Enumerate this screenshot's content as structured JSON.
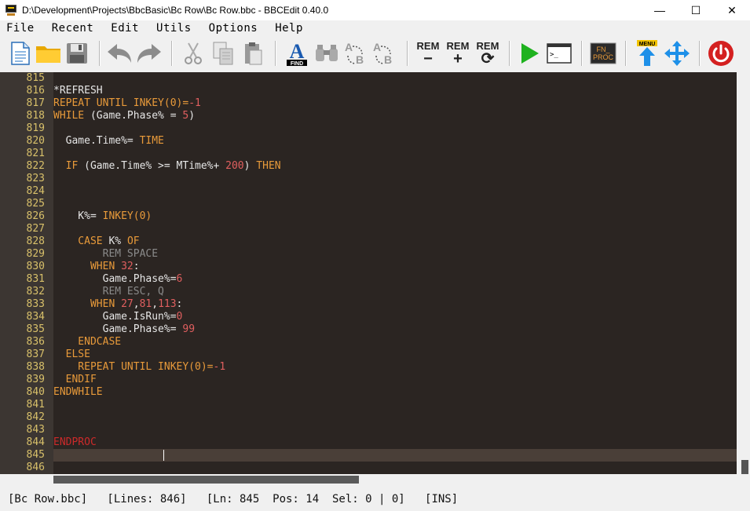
{
  "window": {
    "title": "D:\\Development\\Projects\\BbcBasic\\Bc Row\\Bc Row.bbc - BBCEdit 0.40.0",
    "minimize": "—",
    "maximize": "☐",
    "close": "✕"
  },
  "menu": [
    "File",
    "Recent",
    "Edit",
    "Utils",
    "Options",
    "Help"
  ],
  "toolbar": {
    "find_label": "FIND",
    "rem_label": "REM",
    "menu_label": "MENU",
    "fnproc_line1": "FN_",
    "fnproc_line2": "PROC",
    "terminal_prompt": ">_"
  },
  "colors": {
    "background": "#2b2522",
    "gutter": "#3c3632",
    "keyword": "#e89a3a",
    "number": "#e05f5f",
    "comment": "#8a8a8a",
    "line_number": "#d8c06a"
  },
  "editor": {
    "lines": [
      {
        "n": "815",
        "tokens": []
      },
      {
        "n": "816",
        "tokens": [
          {
            "t": "*REFRESH",
            "c": "tx"
          }
        ]
      },
      {
        "n": "817",
        "tokens": [
          {
            "t": "REPEAT UNTIL INKEY(0)=",
            "c": "kw"
          },
          {
            "t": "-1",
            "c": "num"
          }
        ]
      },
      {
        "n": "818",
        "tokens": [
          {
            "t": "WHILE ",
            "c": "kw"
          },
          {
            "t": "(Game.Phase% = ",
            "c": "tx"
          },
          {
            "t": "5",
            "c": "num"
          },
          {
            "t": ")",
            "c": "tx"
          }
        ]
      },
      {
        "n": "819",
        "tokens": []
      },
      {
        "n": "820",
        "tokens": [
          {
            "t": "  Game.Time%= ",
            "c": "tx"
          },
          {
            "t": "TIME",
            "c": "kw"
          }
        ]
      },
      {
        "n": "821",
        "tokens": []
      },
      {
        "n": "822",
        "tokens": [
          {
            "t": "  IF ",
            "c": "kw"
          },
          {
            "t": "(Game.Time% >= MTime%+ ",
            "c": "tx"
          },
          {
            "t": "200",
            "c": "num"
          },
          {
            "t": ") ",
            "c": "tx"
          },
          {
            "t": "THEN",
            "c": "kw"
          }
        ]
      },
      {
        "n": "823",
        "tokens": []
      },
      {
        "n": "824",
        "tokens": []
      },
      {
        "n": "825",
        "tokens": []
      },
      {
        "n": "826",
        "tokens": [
          {
            "t": "    K%= ",
            "c": "tx"
          },
          {
            "t": "INKEY(0)",
            "c": "kw"
          }
        ]
      },
      {
        "n": "827",
        "tokens": []
      },
      {
        "n": "828",
        "tokens": [
          {
            "t": "    CASE ",
            "c": "kw"
          },
          {
            "t": "K% ",
            "c": "tx"
          },
          {
            "t": "OF",
            "c": "kw"
          }
        ]
      },
      {
        "n": "829",
        "tokens": [
          {
            "t": "        REM SPACE",
            "c": "cm"
          }
        ]
      },
      {
        "n": "830",
        "tokens": [
          {
            "t": "      WHEN ",
            "c": "kw"
          },
          {
            "t": "32",
            "c": "num"
          },
          {
            "t": ":",
            "c": "tx"
          }
        ]
      },
      {
        "n": "831",
        "tokens": [
          {
            "t": "        Game.Phase%=",
            "c": "tx"
          },
          {
            "t": "6",
            "c": "num"
          }
        ]
      },
      {
        "n": "832",
        "tokens": [
          {
            "t": "        REM ESC, Q",
            "c": "cm"
          }
        ]
      },
      {
        "n": "833",
        "tokens": [
          {
            "t": "      WHEN ",
            "c": "kw"
          },
          {
            "t": "27",
            "c": "num"
          },
          {
            "t": ",",
            "c": "tx"
          },
          {
            "t": "81",
            "c": "num"
          },
          {
            "t": ",",
            "c": "tx"
          },
          {
            "t": "113",
            "c": "num"
          },
          {
            "t": ":",
            "c": "tx"
          }
        ]
      },
      {
        "n": "834",
        "tokens": [
          {
            "t": "        Game.IsRun%=",
            "c": "tx"
          },
          {
            "t": "0",
            "c": "num"
          }
        ]
      },
      {
        "n": "835",
        "tokens": [
          {
            "t": "        Game.Phase%= ",
            "c": "tx"
          },
          {
            "t": "99",
            "c": "num"
          }
        ]
      },
      {
        "n": "836",
        "tokens": [
          {
            "t": "    ENDCASE",
            "c": "kw"
          }
        ]
      },
      {
        "n": "837",
        "tokens": [
          {
            "t": "  ELSE",
            "c": "kw"
          }
        ]
      },
      {
        "n": "838",
        "tokens": [
          {
            "t": "    REPEAT UNTIL INKEY(0)=",
            "c": "kw"
          },
          {
            "t": "-1",
            "c": "num"
          }
        ]
      },
      {
        "n": "839",
        "tokens": [
          {
            "t": "  ENDIF",
            "c": "kw"
          }
        ]
      },
      {
        "n": "840",
        "tokens": [
          {
            "t": "ENDWHILE",
            "c": "kw"
          }
        ]
      },
      {
        "n": "841",
        "tokens": []
      },
      {
        "n": "842",
        "tokens": []
      },
      {
        "n": "843",
        "tokens": []
      },
      {
        "n": "844",
        "tokens": [
          {
            "t": "ENDPROC",
            "c": "ep"
          }
        ]
      },
      {
        "n": "845",
        "tokens": []
      },
      {
        "n": "846",
        "tokens": []
      }
    ]
  },
  "status": "[Bc Row.bbc]   [Lines: 846]   [Ln: 845  Pos: 14  Sel: 0 | 0]   [INS]"
}
